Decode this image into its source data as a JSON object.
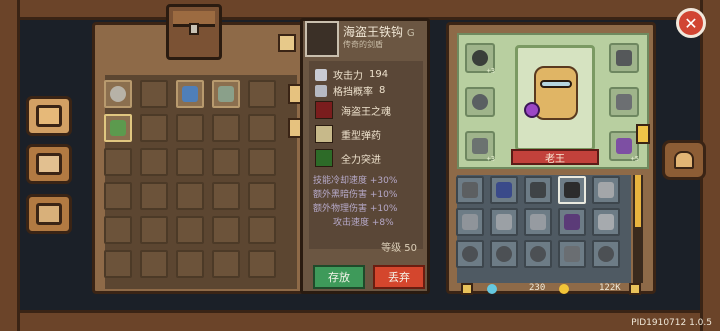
{
  "tooltip": {
    "item_name": "海盗王铁钩",
    "item_tag": "G",
    "item_subtitle": "传奇的剑盾",
    "stats": [
      {
        "icon": "sword-icon",
        "label": "攻击力",
        "value": "194"
      },
      {
        "icon": "shield-icon",
        "label": "格挡概率",
        "value": "8"
      }
    ],
    "skills": [
      {
        "icon": "pirate-soul-icon",
        "label": "海盗王之魂"
      },
      {
        "icon": "heavy-ammo-icon",
        "label": "重型弹药"
      },
      {
        "icon": "charge-icon",
        "label": "全力突进"
      }
    ],
    "bonuses": [
      "技能冷却速度 +30%",
      "额外黑暗伤害 +10%",
      "额外物理伤害 +10%",
      "攻击速度 +8%"
    ],
    "level_text": "等级 50",
    "store_button": "存放",
    "drop_button": "丢弃"
  },
  "character": {
    "name": "老王",
    "equip_badges": [
      "+3",
      "+3",
      "+5"
    ]
  },
  "footer": {
    "gems": "230",
    "coins": "122K"
  },
  "pid": "PID1910712 1.0.5",
  "colors": {
    "store_button": "#3e9a5a",
    "drop_button": "#d4462d",
    "name_bar": "#c2413b",
    "close_button": "#d14533",
    "scroll_thumb": "#e8b43f"
  }
}
